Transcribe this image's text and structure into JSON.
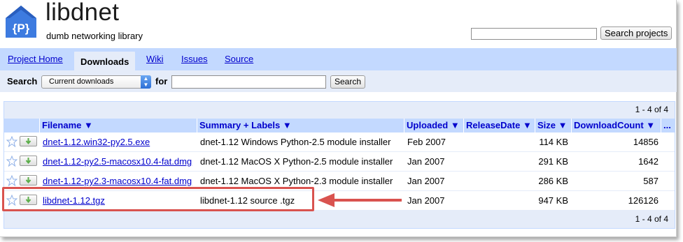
{
  "header": {
    "logo_letter": "{P}",
    "title": "libdnet",
    "subtitle": "dumb networking library",
    "search_projects_value": "",
    "search_projects_label": "Search projects"
  },
  "tabs": [
    {
      "label": "Project Home"
    },
    {
      "label": "Downloads"
    },
    {
      "label": "Wiki"
    },
    {
      "label": "Issues"
    },
    {
      "label": "Source"
    }
  ],
  "search": {
    "label": "Search",
    "scope": "Current downloads",
    "for_label": "for",
    "query": "",
    "button": "Search"
  },
  "table": {
    "count": "1 - 4 of 4",
    "columns": [
      "Filename ▼",
      "Summary + Labels ▼",
      "Uploaded ▼",
      "ReleaseDate ▼",
      "Size ▼",
      "DownloadCount ▼",
      "..."
    ],
    "rows": [
      {
        "filename": "dnet-1.12.win32-py2.5.exe",
        "summary": "dnet-1.12 Windows Python-2.5 module installer",
        "uploaded": "Feb 2007",
        "release": "",
        "size": "114 KB",
        "downloads": "14856"
      },
      {
        "filename": "dnet-1.12-py2.5-macosx10.4-fat.dmg",
        "summary": "dnet-1.12 MacOS X Python-2.5 module installer",
        "uploaded": "Jan 2007",
        "release": "",
        "size": "291 KB",
        "downloads": "1642"
      },
      {
        "filename": "dnet-1.12-py2.3-macosx10.4-fat.dmg",
        "summary": "dnet-1.12 MacOS X Python-2.3 module installer",
        "uploaded": "Jan 2007",
        "release": "",
        "size": "286 KB",
        "downloads": "587"
      },
      {
        "filename": "libdnet-1.12.tgz",
        "summary": "libdnet-1.12 source .tgz",
        "uploaded": "Jan 2007",
        "release": "",
        "size": "947 KB",
        "downloads": "126126"
      }
    ]
  },
  "colors": {
    "tab_bar": "#c3d9ff",
    "panel": "#e5ecf9",
    "link": "#0000cc",
    "highlight": "#d9534f",
    "logo": "#3d7be0"
  }
}
